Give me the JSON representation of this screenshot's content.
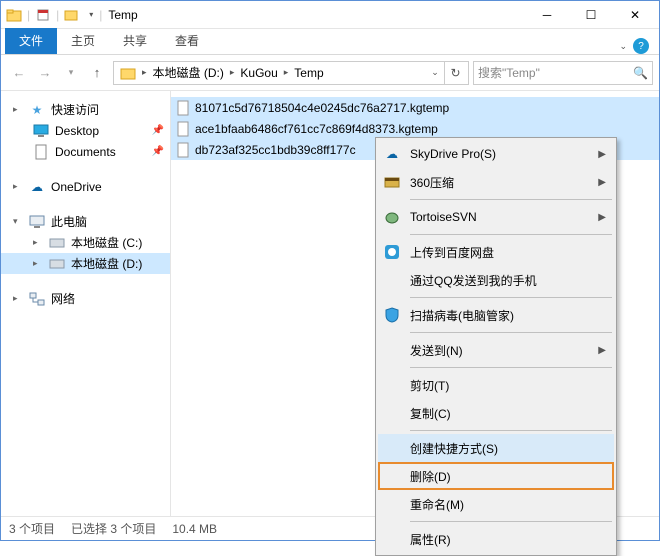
{
  "window": {
    "title": "Temp",
    "sep": "|"
  },
  "ribbon": {
    "file": "文件",
    "tabs": [
      "主页",
      "共享",
      "查看"
    ]
  },
  "breadcrumb": {
    "segs": [
      "本地磁盘 (D:)",
      "KuGou",
      "Temp"
    ]
  },
  "search": {
    "placeholder": "搜索\"Temp\""
  },
  "sidebar": {
    "quick": "快速访问",
    "desktop": "Desktop",
    "documents": "Documents",
    "onedrive": "OneDrive",
    "thispc": "此电脑",
    "driveC": "本地磁盘 (C:)",
    "driveD": "本地磁盘 (D:)",
    "network": "网络"
  },
  "files": [
    "81071c5d76718504c4e0245dc76a2717.kgtemp",
    "ace1bfaab6486cf761cc7c869f4d8373.kgtemp",
    "db723af325cc1bdb39c8ff177c"
  ],
  "status": {
    "count": "3 个项目",
    "selected": "已选择 3 个项目",
    "size": "10.4 MB"
  },
  "ctx": {
    "skydrive": "SkyDrive Pro(S)",
    "zip360": "360压缩",
    "tortoise": "TortoiseSVN",
    "baidu": "上传到百度网盘",
    "qq": "通过QQ发送到我的手机",
    "scan": "扫描病毒(电脑管家)",
    "sendto": "发送到(N)",
    "cut": "剪切(T)",
    "copy": "复制(C)",
    "shortcut": "创建快捷方式(S)",
    "delete": "删除(D)",
    "rename": "重命名(M)",
    "props": "属性(R)"
  }
}
